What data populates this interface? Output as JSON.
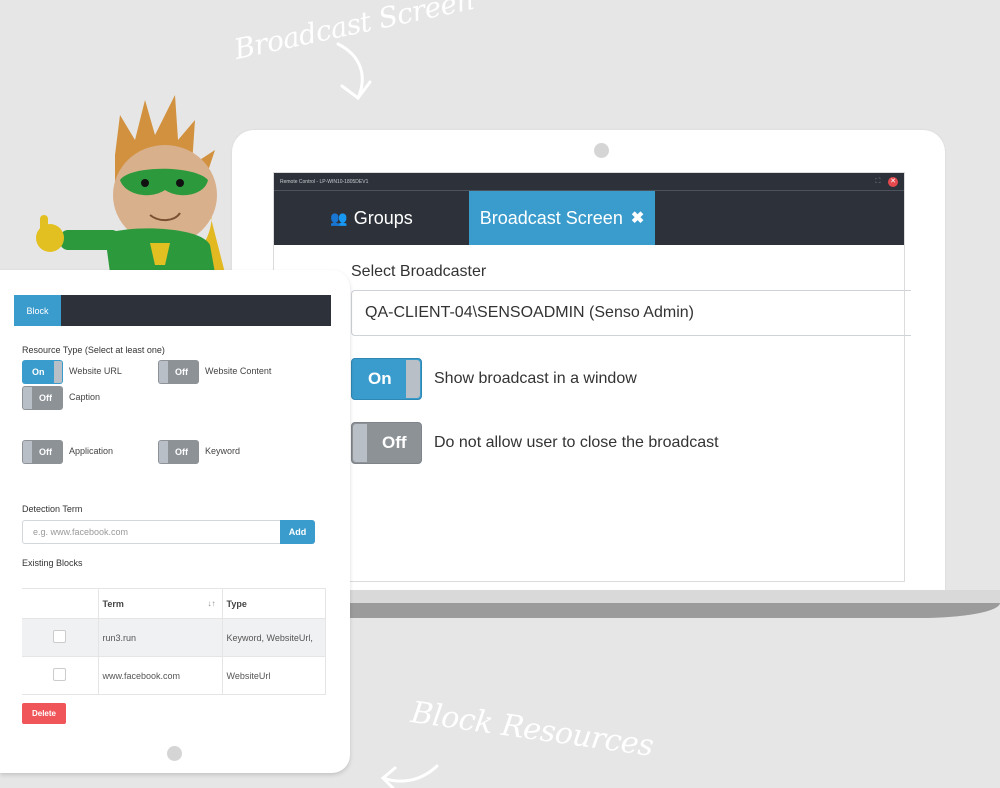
{
  "annotations": {
    "broadcast_screen": "Broadcast Screen",
    "block_resources": "Block Resources"
  },
  "broadcast_window": {
    "title": "Remote Control - LP-WIN10-1805DEV1",
    "title_buttons": {
      "maximize_icon": "maximize-icon",
      "close_icon": "close-icon"
    },
    "tabs": [
      {
        "label": "Groups",
        "icon": "users-icon",
        "active": false
      },
      {
        "label": "Broadcast Screen",
        "icon": "close-icon",
        "active": true
      }
    ],
    "select_broadcaster_label": "Select Broadcaster",
    "selected_broadcaster": "QA-CLIENT-04\\SENSOADMIN (Senso Admin)",
    "options": [
      {
        "state": "On",
        "label": "Show broadcast in a window"
      },
      {
        "state": "Off",
        "label": "Do not allow user to close the broadcast"
      }
    ]
  },
  "block_panel": {
    "tab_label": "Block",
    "resource_type_label": "Resource Type (Select at least one)",
    "resource_types": [
      {
        "state": "On",
        "label": "Website URL"
      },
      {
        "state": "Off",
        "label": "Website Content"
      },
      {
        "state": "Off",
        "label": "Caption"
      },
      {
        "state": "Off",
        "label": "Application"
      },
      {
        "state": "Off",
        "label": "Keyword"
      }
    ],
    "detection_term_label": "Detection Term",
    "detection_term_placeholder": "e.g. www.facebook.com",
    "add_label": "Add",
    "existing_blocks_label": "Existing Blocks",
    "table": {
      "columns": [
        "",
        "Term",
        "Type"
      ],
      "rows": [
        {
          "term": "run3.run",
          "type": "Keyword, WebsiteUrl,"
        },
        {
          "term": "www.facebook.com",
          "type": "WebsiteUrl"
        }
      ]
    },
    "delete_label": "Delete"
  },
  "colors": {
    "accent": "#3a9ccc",
    "dark_bar": "#2d323a",
    "toggle_off": "#8d9297",
    "danger": "#f0555a"
  }
}
